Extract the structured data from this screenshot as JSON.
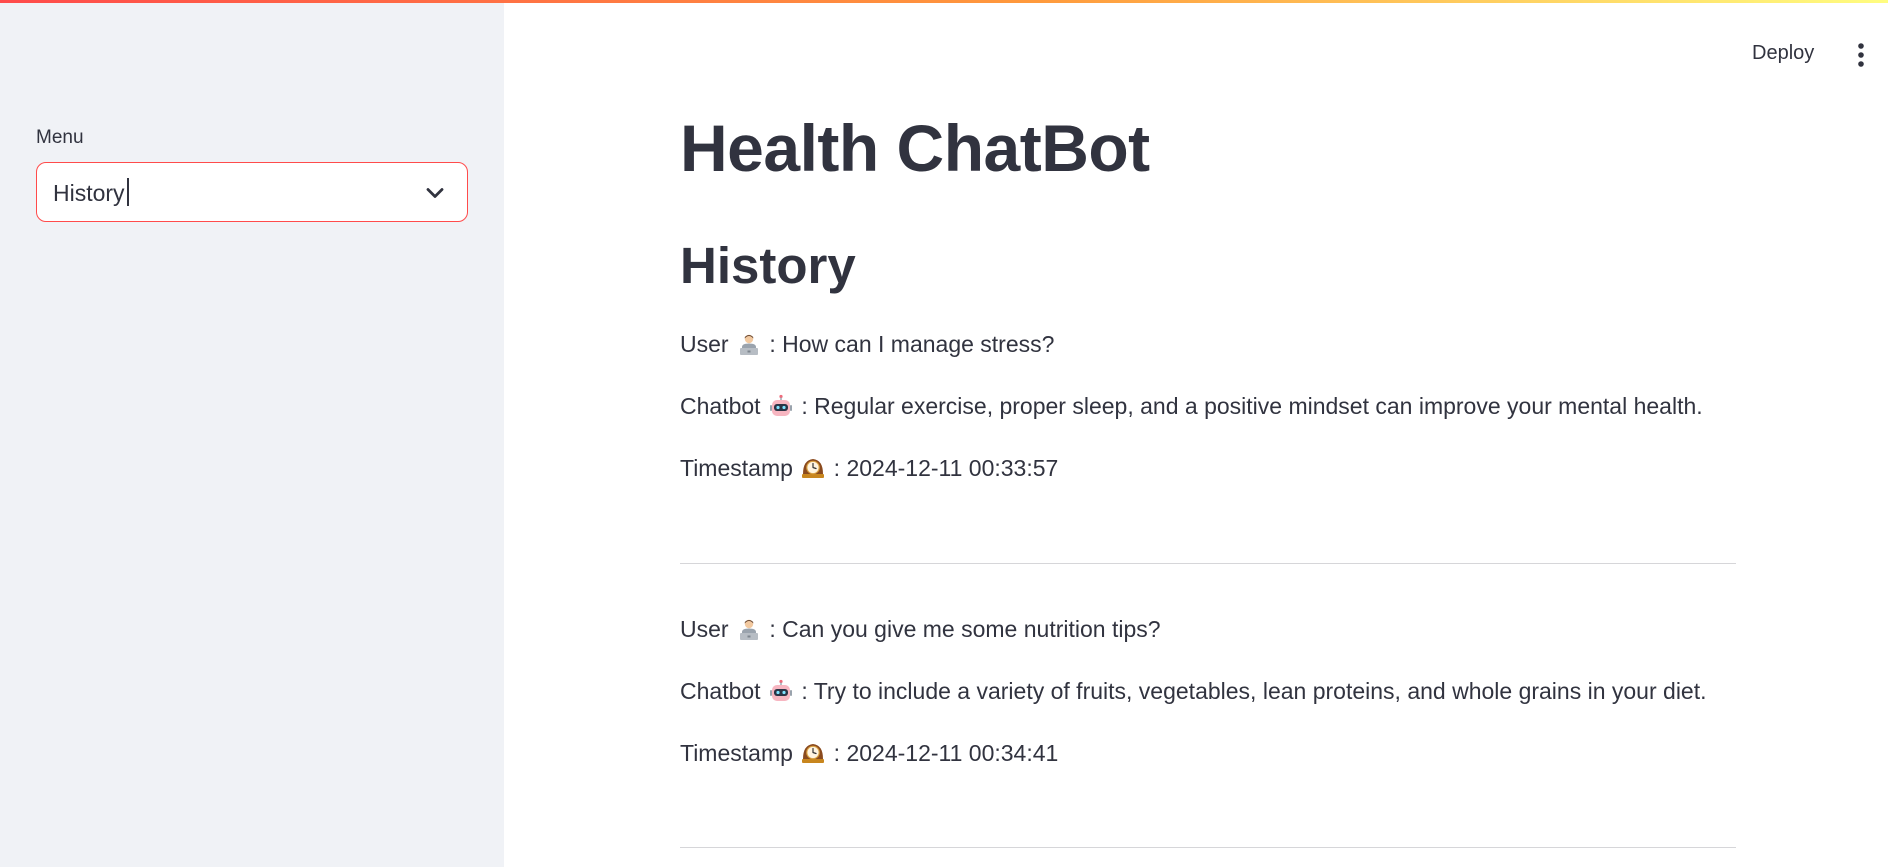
{
  "sidebar": {
    "menu_label": "Menu",
    "select_value": "History"
  },
  "header": {
    "deploy_label": "Deploy"
  },
  "main": {
    "title": "Health ChatBot",
    "section_title": "History",
    "entries": [
      {
        "user_label": "User",
        "user_text": ": How can I manage stress?",
        "bot_label": "Chatbot",
        "bot_text": ": Regular exercise, proper sleep, and a positive mindset can improve your mental health.",
        "ts_label": "Timestamp",
        "ts_text": ": 2024-12-11 00:33:57"
      },
      {
        "user_label": "User",
        "user_text": ": Can you give me some nutrition tips?",
        "bot_label": "Chatbot",
        "bot_text": ": Try to include a variety of fruits, vegetables, lean proteins, and whole grains in your diet.",
        "ts_label": "Timestamp",
        "ts_text": ": 2024-12-11 00:34:41"
      }
    ]
  },
  "icons": {
    "user": "technologist-emoji",
    "bot": "robot-emoji",
    "timestamp": "mantelpiece-clock-emoji",
    "select": "chevron-down-icon",
    "menu": "kebab-menu-icon"
  },
  "colors": {
    "accent": "#ff4b4b",
    "sidebar_bg": "#f0f2f6",
    "text": "#31333f"
  }
}
